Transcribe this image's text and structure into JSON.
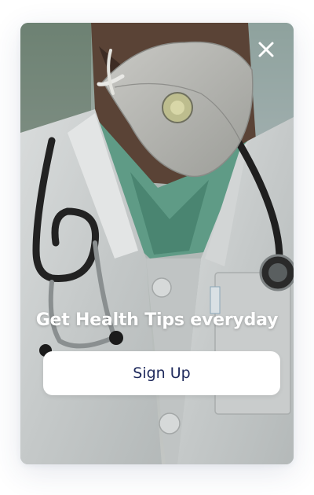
{
  "popup": {
    "headline": "Get Health Tips everyday",
    "cta_label": "Sign Up",
    "close_icon": "close-icon",
    "photo_subject": "doctor with face mask and stethoscope",
    "colors": {
      "cta_text": "#1f2a5c",
      "cta_background": "#ffffff",
      "headline": "#ffffff",
      "close_icon": "#ffffff"
    }
  }
}
